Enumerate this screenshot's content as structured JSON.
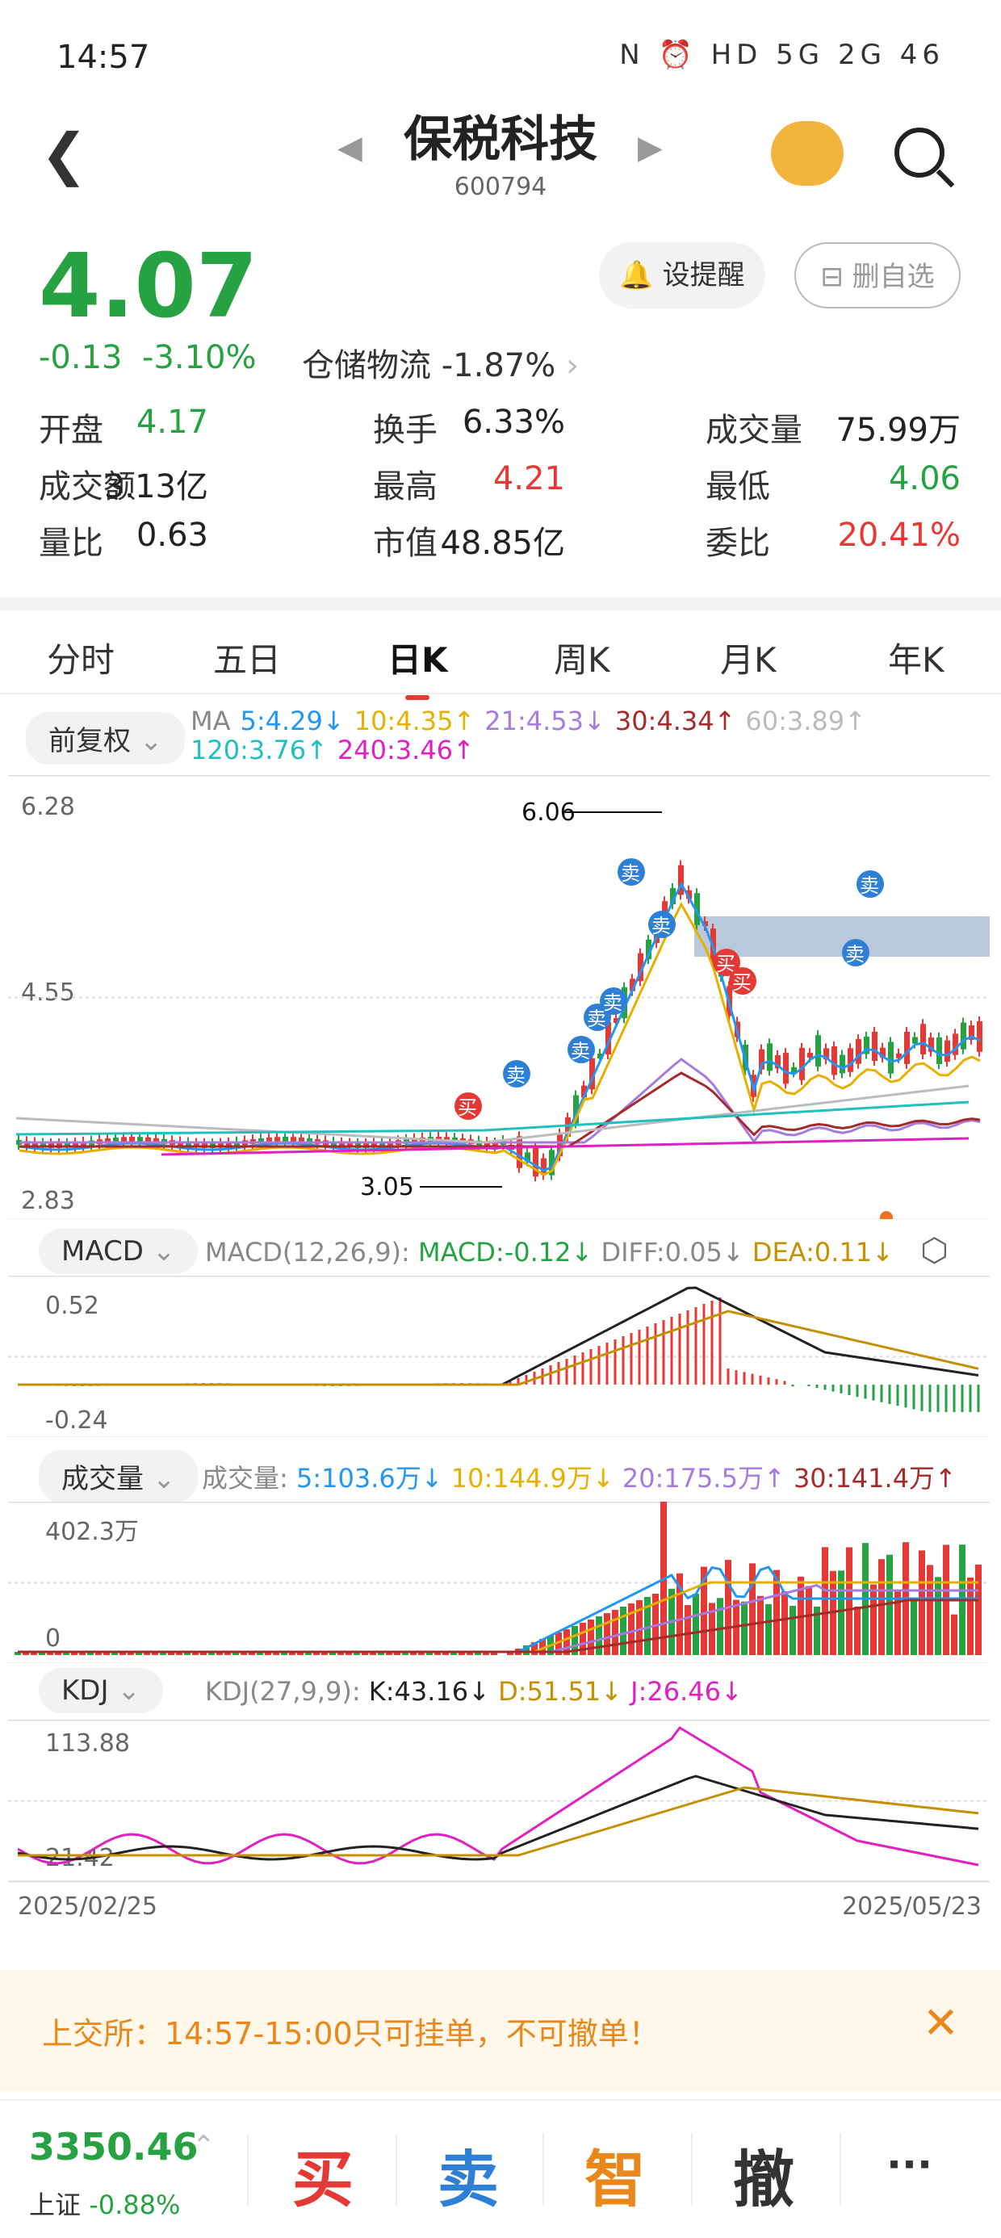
{
  "status_bar": {
    "time": "14:57",
    "icons_text": "N ⏰ HD 5G 2G 46"
  },
  "header": {
    "title": "保税科技",
    "code": "600794"
  },
  "quote": {
    "price": "4.07",
    "change": "-0.13",
    "change_pct": "-3.10%",
    "sector_name": "仓储物流",
    "sector_pct": "-1.87%",
    "alert_label": "设提醒",
    "remove_label": "删自选"
  },
  "stats": [
    {
      "label": "开盘",
      "value": "4.17",
      "color": "#27a243"
    },
    {
      "label": "换手",
      "value": "6.33%",
      "color": "#222"
    },
    {
      "label": "成交量",
      "value": "75.99万",
      "color": "#222"
    },
    {
      "label": "成交额",
      "value": "3.13亿",
      "color": "#222"
    },
    {
      "label": "最高",
      "value": "4.21",
      "color": "#e53935"
    },
    {
      "label": "最低",
      "value": "4.06",
      "color": "#27a243"
    },
    {
      "label": "量比",
      "value": "0.63",
      "color": "#222"
    },
    {
      "label": "市值",
      "value": "48.85亿",
      "color": "#222"
    },
    {
      "label": "委比",
      "value": "20.41%",
      "color": "#e53935"
    }
  ],
  "tabs": [
    "分时",
    "五日",
    "日K",
    "周K",
    "月K",
    "年K"
  ],
  "active_tab": "日K",
  "ma_legend": {
    "adjust": "前复权",
    "items": [
      {
        "text": "MA",
        "color": "#888"
      },
      {
        "text": "5:4.29↓",
        "color": "#2196f3"
      },
      {
        "text": "10:4.35↑",
        "color": "#e6b000"
      },
      {
        "text": "21:4.53↓",
        "color": "#a57be0"
      },
      {
        "text": "30:4.34↑",
        "color": "#a52a2a"
      },
      {
        "text": "60:3.89↑",
        "color": "#bbb"
      }
    ],
    "items2": [
      {
        "text": "120:3.76↑",
        "color": "#20c0c0"
      },
      {
        "text": "240:3.46↑",
        "color": "#e020c0"
      }
    ]
  },
  "kline": {
    "ymax": "6.28",
    "ymid": "4.55",
    "ymin": "2.83",
    "high_mark": "6.06",
    "low_mark": "3.05",
    "buy": "买",
    "sell": "卖"
  },
  "macd": {
    "tag": "MACD",
    "params": "MACD(12,26,9):",
    "macd": "MACD:-0.12↓",
    "diff": "DIFF:0.05↓",
    "dea": "DEA:0.11↓",
    "ymax": "0.52",
    "ymin": "-0.24"
  },
  "volume": {
    "tag": "成交量",
    "label": "成交量:",
    "v5": "5:103.6万↓",
    "v10": "10:144.9万↓",
    "v20": "20:175.5万↑",
    "v30": "30:141.4万↑",
    "ymax": "402.3万",
    "ymin": "0"
  },
  "kdj": {
    "tag": "KDJ",
    "params": "KDJ(27,9,9):",
    "k": "K:43.16↓",
    "d": "D:51.51↓",
    "j": "J:26.46↓",
    "ymax": "113.88",
    "ymin": "21.42"
  },
  "dates": {
    "start": "2025/02/25",
    "end": "2025/05/23"
  },
  "notice": {
    "text": "上交所：14:57-15:00只可挂单，不可撤单！"
  },
  "bottom": {
    "index_value": "3350.46",
    "index_name": "上证",
    "index_pct": "-0.88%",
    "buy": "买",
    "sell": "卖",
    "smart": "智",
    "cancel": "撤",
    "more": "···"
  },
  "colors": {
    "up": "#e53935",
    "down": "#27a243",
    "accent": "#e53935"
  }
}
